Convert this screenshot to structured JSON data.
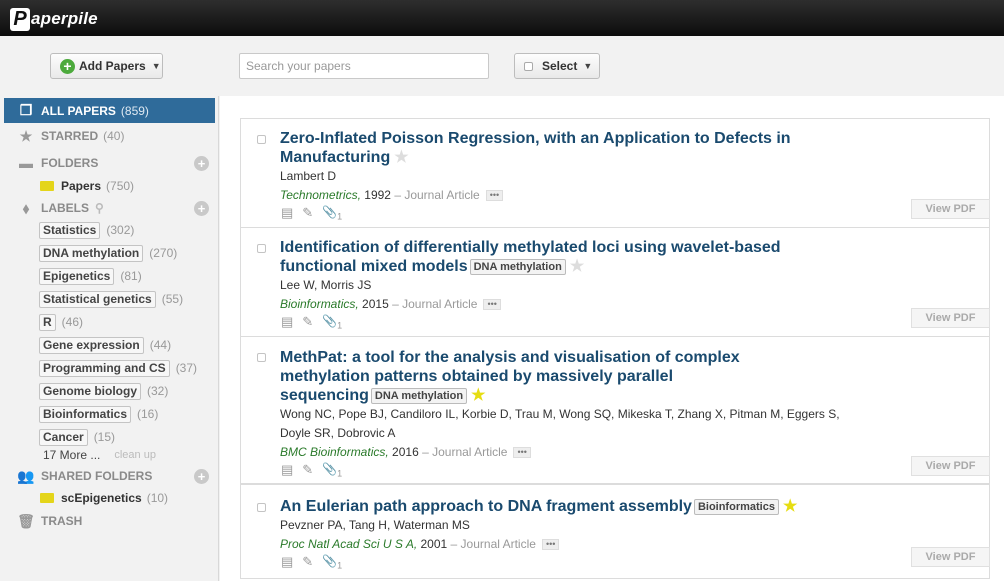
{
  "app": {
    "logo_letter": "P",
    "logo_text": "aperpile"
  },
  "toolbar": {
    "add_label": "Add Papers",
    "search_placeholder": "Search your papers",
    "select_label": "Select"
  },
  "sidebar": {
    "all_papers": {
      "label": "ALL PAPERS",
      "count": "(859)"
    },
    "starred": {
      "label": "STARRED",
      "count": "(40)"
    },
    "folders": {
      "label": "FOLDERS",
      "items": [
        {
          "label": "Papers",
          "count": "(750)"
        }
      ]
    },
    "labels": {
      "label": "LABELS",
      "items": [
        {
          "label": "Statistics",
          "count": "(302)"
        },
        {
          "label": "DNA methylation",
          "count": "(270)"
        },
        {
          "label": "Epigenetics",
          "count": "(81)"
        },
        {
          "label": "Statistical genetics",
          "count": "(55)"
        },
        {
          "label": "R",
          "count": "(46)"
        },
        {
          "label": "Gene expression",
          "count": "(44)"
        },
        {
          "label": "Programming and CS",
          "count": "(37)"
        },
        {
          "label": "Genome biology",
          "count": "(32)"
        },
        {
          "label": "Bioinformatics",
          "count": "(16)"
        },
        {
          "label": "Cancer",
          "count": "(15)"
        }
      ],
      "more": "17 More ...",
      "cleanup": "clean up"
    },
    "shared": {
      "label": "SHARED FOLDERS",
      "items": [
        {
          "label": "scEpigenetics",
          "count": "(10)"
        }
      ]
    },
    "trash": {
      "label": "TRASH"
    }
  },
  "papers": [
    {
      "title": "Zero-Inflated Poisson Regression, with an Application to Defects in Manufacturing",
      "tag": "",
      "starred": false,
      "authors": "Lambert D",
      "journal": "Technometrics,",
      "year": "1992",
      "type": "– Journal Article",
      "attachments": "1",
      "pdf": "View PDF"
    },
    {
      "title": "Identification of differentially methylated loci using wavelet-based functional mixed models",
      "tag": "DNA methylation",
      "starred": false,
      "authors": "Lee W, Morris JS",
      "journal": "Bioinformatics,",
      "year": "2015",
      "type": "– Journal Article",
      "attachments": "1",
      "pdf": "View PDF"
    },
    {
      "title": "MethPat: a tool for the analysis and visualisation of complex methylation patterns obtained by massively parallel sequencing",
      "tag": "DNA methylation",
      "starred": true,
      "authors": "Wong NC, Pope BJ, Candiloro IL, Korbie D, Trau M, Wong SQ, Mikeska T, Zhang X, Pitman M, Eggers S, Doyle SR, Dobrovic A",
      "journal": "BMC Bioinformatics,",
      "year": "2016",
      "type": "– Journal Article",
      "attachments": "1",
      "pdf": "View PDF"
    },
    {
      "title": "An Eulerian path approach to DNA fragment assembly",
      "tag": "Bioinformatics",
      "starred": true,
      "authors": "Pevzner PA, Tang H, Waterman MS",
      "journal": "Proc Natl Acad Sci U S A,",
      "year": "2001",
      "type": "– Journal Article",
      "attachments": "1",
      "pdf": "View PDF"
    }
  ],
  "icons": {
    "star_on": "#e6dd12",
    "accent": "#2f6b9a",
    "title_color": "#1a4a6e",
    "journal_color": "#2a7a2a"
  }
}
